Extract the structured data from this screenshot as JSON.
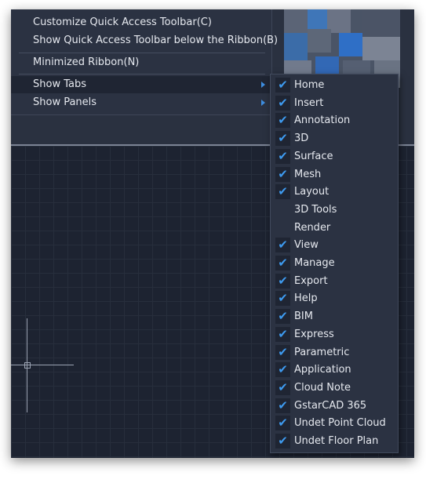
{
  "context_menu": {
    "items": [
      {
        "label": "Customize Quick Access Toolbar(C)"
      },
      {
        "label": "Show Quick Access Toolbar below the Ribbon(B)"
      },
      {
        "label": "Minimized Ribbon(N)"
      },
      {
        "label": "Show Tabs"
      },
      {
        "label": "Show Panels"
      }
    ]
  },
  "tabs_submenu": {
    "items": [
      {
        "label": "Home",
        "checked": true
      },
      {
        "label": "Insert",
        "checked": true
      },
      {
        "label": "Annotation",
        "checked": true
      },
      {
        "label": "3D",
        "checked": true
      },
      {
        "label": "Surface",
        "checked": true
      },
      {
        "label": "Mesh",
        "checked": true
      },
      {
        "label": "Layout",
        "checked": true
      },
      {
        "label": "3D Tools",
        "checked": false
      },
      {
        "label": "Render",
        "checked": false
      },
      {
        "label": "View",
        "checked": true
      },
      {
        "label": "Manage",
        "checked": true
      },
      {
        "label": "Export",
        "checked": true
      },
      {
        "label": "Help",
        "checked": true
      },
      {
        "label": "BIM",
        "checked": true
      },
      {
        "label": "Express",
        "checked": true
      },
      {
        "label": "Parametric",
        "checked": true
      },
      {
        "label": "Application",
        "checked": true
      },
      {
        "label": "Cloud Note",
        "checked": true
      },
      {
        "label": "GstarCAD 365",
        "checked": true
      },
      {
        "label": "Undet Point Cloud",
        "checked": true
      },
      {
        "label": "Undet Floor Plan",
        "checked": true
      }
    ]
  },
  "colors": {
    "menu_bg": "#2b3242",
    "check": "#3e9bf0",
    "canvas_bg": "#1d2331"
  },
  "icons": {
    "check": "checkmark-icon",
    "submenu": "submenu-arrow-icon"
  }
}
